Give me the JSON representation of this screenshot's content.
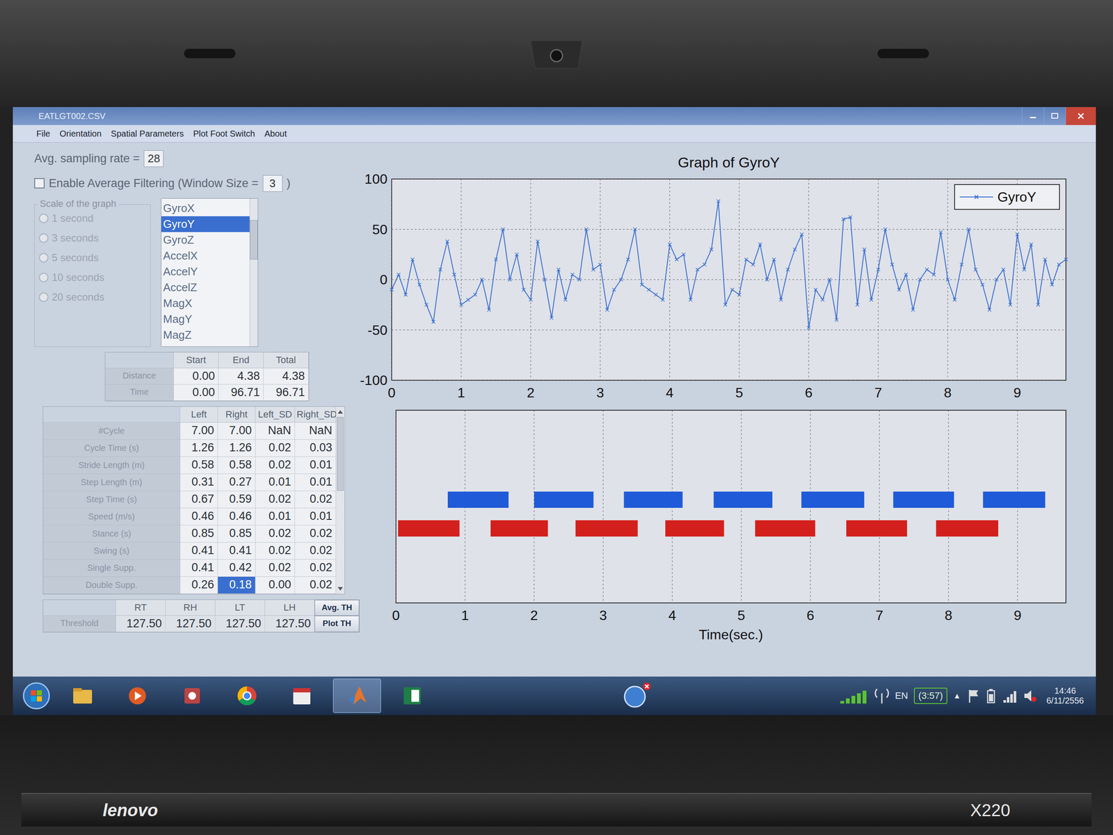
{
  "window": {
    "title": "EATLGT002.CSV"
  },
  "menu": [
    "File",
    "Orientation",
    "Spatial Parameters",
    "Plot Foot Switch",
    "About"
  ],
  "sampling": {
    "label": "Avg. sampling rate =",
    "value": "28"
  },
  "filtering": {
    "checked": false,
    "label": "Enable Average Filtering (Window Size =",
    "value": "3",
    "suffix": ")"
  },
  "scale": {
    "title": "Scale of the graph",
    "options": [
      {
        "label": "1 second",
        "selected": false,
        "disabled": true
      },
      {
        "label": "3 seconds",
        "selected": false,
        "disabled": true
      },
      {
        "label": "5 seconds",
        "selected": false,
        "disabled": true
      },
      {
        "label": "10 seconds",
        "selected": false,
        "disabled": true
      },
      {
        "label": "20 seconds",
        "selected": false,
        "disabled": true
      }
    ]
  },
  "signals": [
    {
      "label": "GyroX",
      "selected": false
    },
    {
      "label": "GyroY",
      "selected": true
    },
    {
      "label": "GyroZ",
      "selected": false
    },
    {
      "label": "AccelX",
      "selected": false
    },
    {
      "label": "AccelY",
      "selected": false
    },
    {
      "label": "AccelZ",
      "selected": false
    },
    {
      "label": "MagX",
      "selected": false
    },
    {
      "label": "MagY",
      "selected": false
    },
    {
      "label": "MagZ",
      "selected": false
    }
  ],
  "span_table": {
    "columns": [
      "Start",
      "End",
      "Total"
    ],
    "rows": [
      {
        "label": "Distance",
        "cells": [
          "0.00",
          "4.38",
          "4.38"
        ]
      },
      {
        "label": "Time",
        "cells": [
          "0.00",
          "96.71",
          "96.71"
        ]
      }
    ]
  },
  "gait_table": {
    "columns": [
      "Left",
      "Right",
      "Left_SD",
      "Right_SD"
    ],
    "rows": [
      {
        "label": "#Cycle",
        "cells": [
          {
            "text": "7.00",
            "selected": false
          },
          {
            "text": "7.00",
            "selected": false
          },
          {
            "text": "NaN",
            "selected": false
          },
          {
            "text": "NaN",
            "selected": false
          }
        ]
      },
      {
        "label": "Cycle Time (s)",
        "cells": [
          {
            "text": "1.26",
            "selected": false
          },
          {
            "text": "1.26",
            "selected": false
          },
          {
            "text": "0.02",
            "selected": false
          },
          {
            "text": "0.03",
            "selected": false
          }
        ]
      },
      {
        "label": "Stride Length (m)",
        "cells": [
          {
            "text": "0.58",
            "selected": false
          },
          {
            "text": "0.58",
            "selected": false
          },
          {
            "text": "0.02",
            "selected": false
          },
          {
            "text": "0.01",
            "selected": false
          }
        ]
      },
      {
        "label": "Step Length (m)",
        "cells": [
          {
            "text": "0.31",
            "selected": false
          },
          {
            "text": "0.27",
            "selected": false
          },
          {
            "text": "0.01",
            "selected": false
          },
          {
            "text": "0.01",
            "selected": false
          }
        ]
      },
      {
        "label": "Step Time (s)",
        "cells": [
          {
            "text": "0.67",
            "selected": false
          },
          {
            "text": "0.59",
            "selected": false
          },
          {
            "text": "0.02",
            "selected": false
          },
          {
            "text": "0.02",
            "selected": false
          }
        ]
      },
      {
        "label": "Speed (m/s)",
        "cells": [
          {
            "text": "0.46",
            "selected": false
          },
          {
            "text": "0.46",
            "selected": false
          },
          {
            "text": "0.01",
            "selected": false
          },
          {
            "text": "0.01",
            "selected": false
          }
        ]
      },
      {
        "label": "Stance (s)",
        "cells": [
          {
            "text": "0.85",
            "selected": false
          },
          {
            "text": "0.85",
            "selected": false
          },
          {
            "text": "0.02",
            "selected": false
          },
          {
            "text": "0.02",
            "selected": false
          }
        ]
      },
      {
        "label": "Swing (s)",
        "cells": [
          {
            "text": "0.41",
            "selected": false
          },
          {
            "text": "0.41",
            "selected": false
          },
          {
            "text": "0.02",
            "selected": false
          },
          {
            "text": "0.02",
            "selected": false
          }
        ]
      },
      {
        "label": "Single Supp.",
        "cells": [
          {
            "text": "0.41",
            "selected": false
          },
          {
            "text": "0.42",
            "selected": false
          },
          {
            "text": "0.02",
            "selected": false
          },
          {
            "text": "0.02",
            "selected": false
          }
        ]
      },
      {
        "label": "Double Supp.",
        "cells": [
          {
            "text": "0.26",
            "selected": false
          },
          {
            "text": "0.18",
            "selected": true
          },
          {
            "text": "0.00",
            "selected": false
          },
          {
            "text": "0.02",
            "selected": false
          }
        ]
      }
    ]
  },
  "threshold": {
    "label": "Threshold",
    "columns": [
      "RT",
      "RH",
      "LT",
      "LH"
    ],
    "values": [
      "127.50",
      "127.50",
      "127.50",
      "127.50"
    ],
    "buttons": [
      "Avg. TH",
      "Plot TH"
    ]
  },
  "chart_top": {
    "title": "Graph of GyroY",
    "legend": "GyroY",
    "x_min": 0,
    "x_max": 9.7,
    "y_min": -100,
    "y_max": 100,
    "y_ticks": [
      "100",
      "50",
      "0",
      "-50",
      "-100"
    ],
    "x_ticks": [
      "0",
      "1",
      "2",
      "3",
      "4",
      "5",
      "6",
      "7",
      "8",
      "9"
    ],
    "series": [
      {
        "name": "GyroY",
        "color": "#3a6fd0",
        "t_start": 0,
        "t_step": 0.1,
        "values": [
          -10,
          5,
          -15,
          20,
          -5,
          -25,
          -42,
          10,
          38,
          5,
          -25,
          -20,
          -15,
          0,
          -30,
          20,
          50,
          0,
          25,
          -10,
          -20,
          38,
          0,
          -38,
          10,
          -20,
          5,
          0,
          50,
          10,
          15,
          -30,
          -10,
          0,
          20,
          50,
          -5,
          -10,
          -15,
          -20,
          35,
          20,
          25,
          -20,
          10,
          15,
          30,
          78,
          -25,
          -10,
          -15,
          20,
          15,
          35,
          0,
          20,
          -20,
          10,
          30,
          45,
          -48,
          -10,
          -20,
          0,
          -40,
          60,
          62,
          -25,
          30,
          -20,
          10,
          50,
          15,
          -10,
          5,
          -30,
          0,
          10,
          5,
          47,
          0,
          -20,
          15,
          50,
          10,
          -5,
          -30,
          0,
          10,
          -25,
          45,
          10,
          35,
          -25,
          20,
          -5,
          15,
          20
        ]
      }
    ]
  },
  "chart_bottom": {
    "x_label": "Time(sec.)",
    "x_min": 0,
    "x_max": 9.7,
    "x_ticks": [
      "0",
      "1",
      "2",
      "3",
      "4",
      "5",
      "6",
      "7",
      "8",
      "9"
    ],
    "series": [
      {
        "color": "#1f5bd8",
        "row": 0,
        "segments": [
          [
            0.75,
            1.63
          ],
          [
            2.0,
            2.86
          ],
          [
            3.3,
            4.15
          ],
          [
            4.6,
            5.45
          ],
          [
            5.87,
            6.78
          ],
          [
            7.2,
            8.08
          ],
          [
            8.5,
            9.4
          ]
        ]
      },
      {
        "color": "#d4201c",
        "row": 1,
        "segments": [
          [
            0.03,
            0.92
          ],
          [
            1.37,
            2.2
          ],
          [
            2.6,
            3.5
          ],
          [
            3.9,
            4.75
          ],
          [
            5.2,
            6.07
          ],
          [
            6.52,
            7.4
          ],
          [
            7.82,
            8.72
          ]
        ]
      }
    ]
  },
  "taskbar": {
    "apps": [
      {
        "kind": "explorer",
        "active": false
      },
      {
        "kind": "media",
        "active": false
      },
      {
        "kind": "paint",
        "active": false
      },
      {
        "kind": "chrome",
        "active": false
      },
      {
        "kind": "calendar",
        "active": false
      },
      {
        "kind": "matlab",
        "active": true
      },
      {
        "kind": "excel",
        "active": false
      }
    ],
    "lang": "EN",
    "battery": "(3:57)",
    "show_hidden": "▲",
    "time": "14:46",
    "date": "6/11/2556"
  },
  "bezel": {
    "brand": "lenovo",
    "model": "X220"
  }
}
